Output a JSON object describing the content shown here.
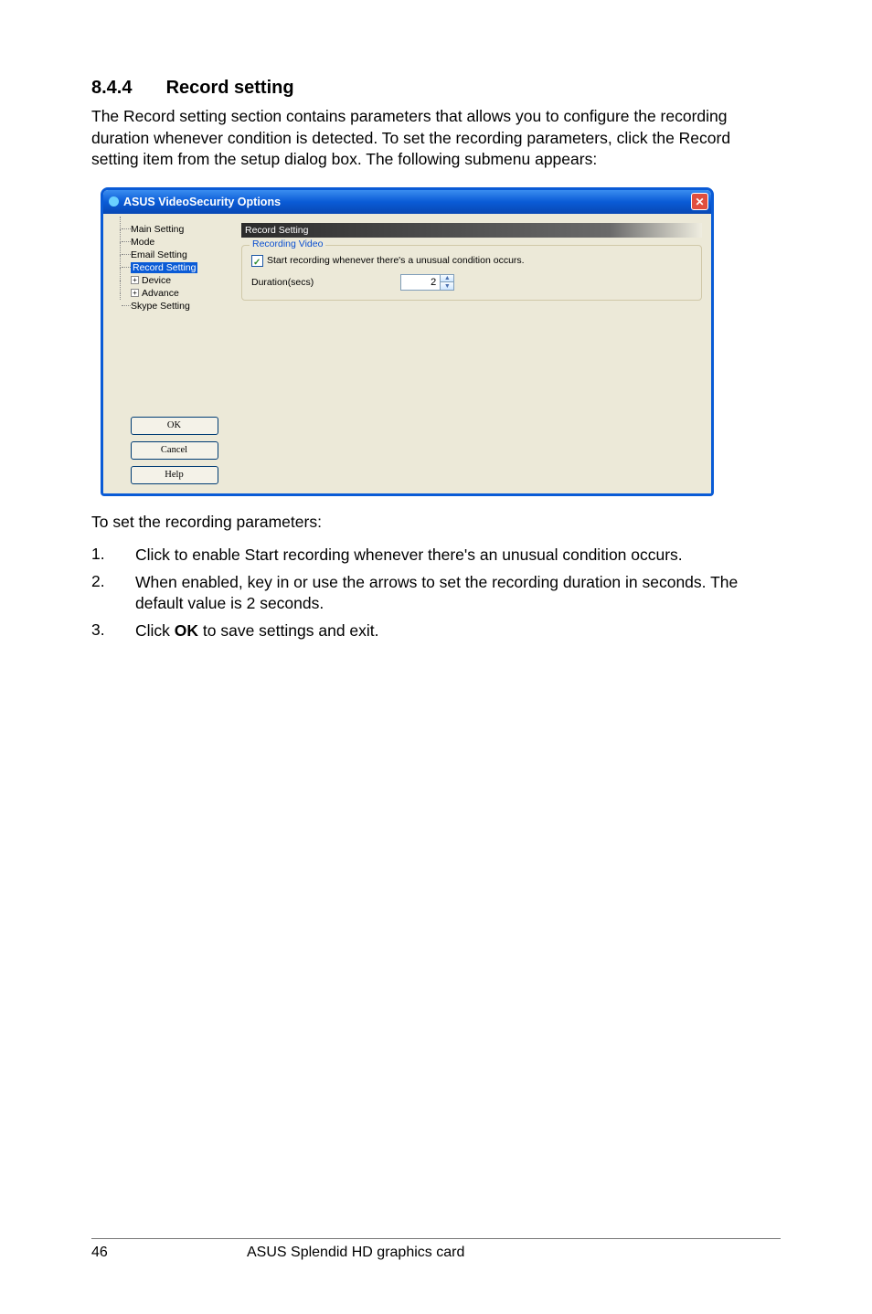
{
  "heading": {
    "number": "8.4.4",
    "title": "Record setting"
  },
  "intro": "The Record setting section contains parameters that allows you to configure the recording duration whenever condition is detected. To set the recording parameters, click the Record setting item from the setup dialog box. The following submenu appears:",
  "dialog": {
    "title": "ASUS VideoSecurity Options",
    "close_glyph": "✕",
    "tree": {
      "items": [
        {
          "label": "Main Setting",
          "expandable": false
        },
        {
          "label": "Mode",
          "expandable": false
        },
        {
          "label": "Email Setting",
          "expandable": false
        },
        {
          "label": "Record Setting",
          "expandable": false,
          "selected": true
        },
        {
          "label": "Device",
          "expandable": true
        },
        {
          "label": "Advance",
          "expandable": true
        },
        {
          "label": "Skype Setting",
          "expandable": false
        }
      ],
      "expand_glyph": "+"
    },
    "buttons": {
      "ok": "OK",
      "cancel": "Cancel",
      "help": "Help"
    },
    "right": {
      "header": "Record Setting",
      "group_legend": "Recording Video",
      "checkbox_label": "Start recording whenever there's a unusual condition occurs.",
      "checkbox_checked": true,
      "duration_label": "Duration(secs)",
      "duration_value": "2",
      "spinner_up": "▲",
      "spinner_down": "▼"
    }
  },
  "after_text": "To set the recording parameters:",
  "steps": [
    {
      "num": "1.",
      "text_before": "Click to enable Start recording whenever there's an unusual condition occurs."
    },
    {
      "num": "2.",
      "text_before": "When enabled, key in or use the arrows to set the recording duration in seconds. The default value is 2 seconds."
    },
    {
      "num": "3.",
      "text_before": "Click ",
      "bold": "OK",
      "text_after": " to save settings and exit."
    }
  ],
  "footer": {
    "page": "46",
    "center": "ASUS Splendid HD graphics card"
  }
}
